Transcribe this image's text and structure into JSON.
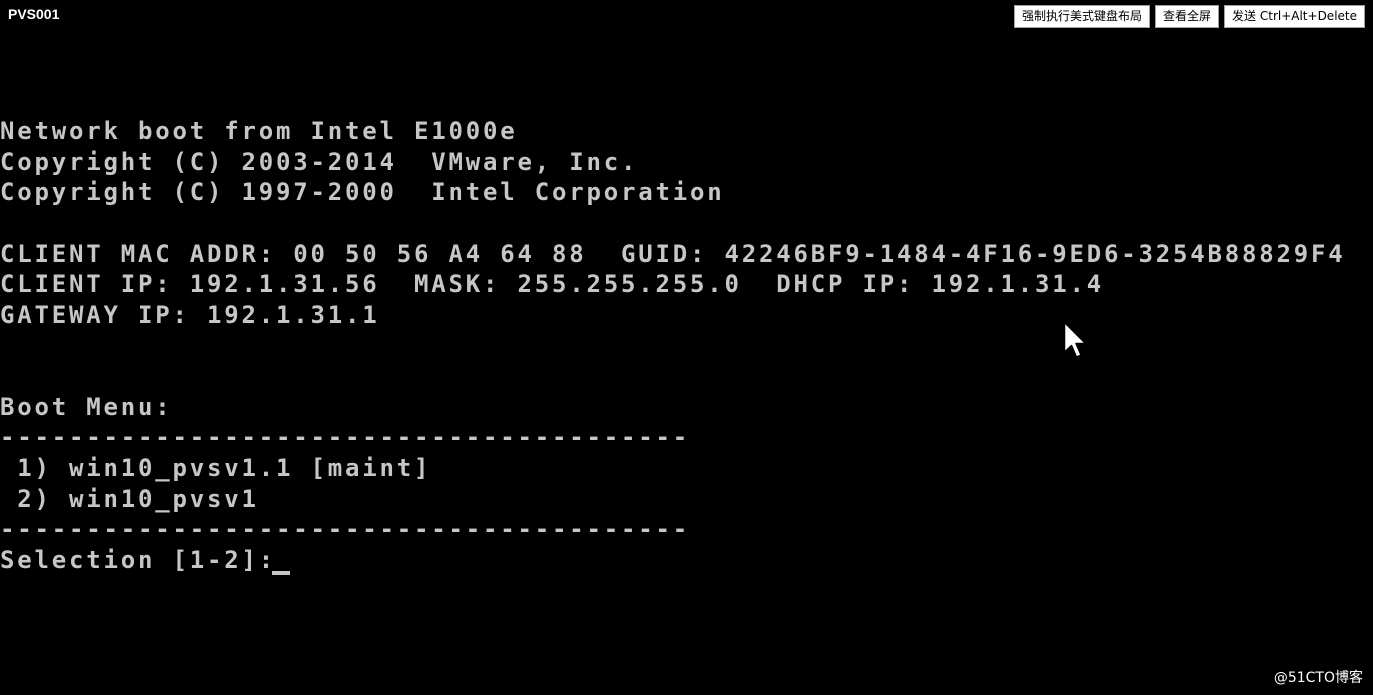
{
  "window": {
    "title": "PVS001"
  },
  "toolbar": {
    "force_us_keyboard_label": "强制执行美式键盘布局",
    "fullscreen_label": "查看全屏",
    "send_cad_label": "发送 Ctrl+Alt+Delete"
  },
  "console": {
    "lines": [
      "Network boot from Intel E1000e",
      "Copyright (C) 2003-2014  VMware, Inc.",
      "Copyright (C) 1997-2000  Intel Corporation",
      "CLIENT MAC ADDR: 00 50 56 A4 64 88  GUID: 42246BF9-1484-4F16-9ED6-3254B88829F4",
      "CLIENT IP: 192.1.31.56  MASK: 255.255.255.0  DHCP IP: 192.1.31.4",
      "GATEWAY IP: 192.1.31.1",
      "Boot Menu:",
      "----------------------------------------",
      " 1) win10_pvsv1.1 [maint]",
      " 2) win10_pvsv1",
      "----------------------------------------",
      "Selection [1-2]:"
    ]
  },
  "watermark": {
    "text": "@51CTO博客"
  },
  "icons": {
    "pointer": "mouse-pointer-icon"
  },
  "colors": {
    "background": "#000000",
    "console_text": "#c6c6c6",
    "button_bg": "#ffffff"
  }
}
